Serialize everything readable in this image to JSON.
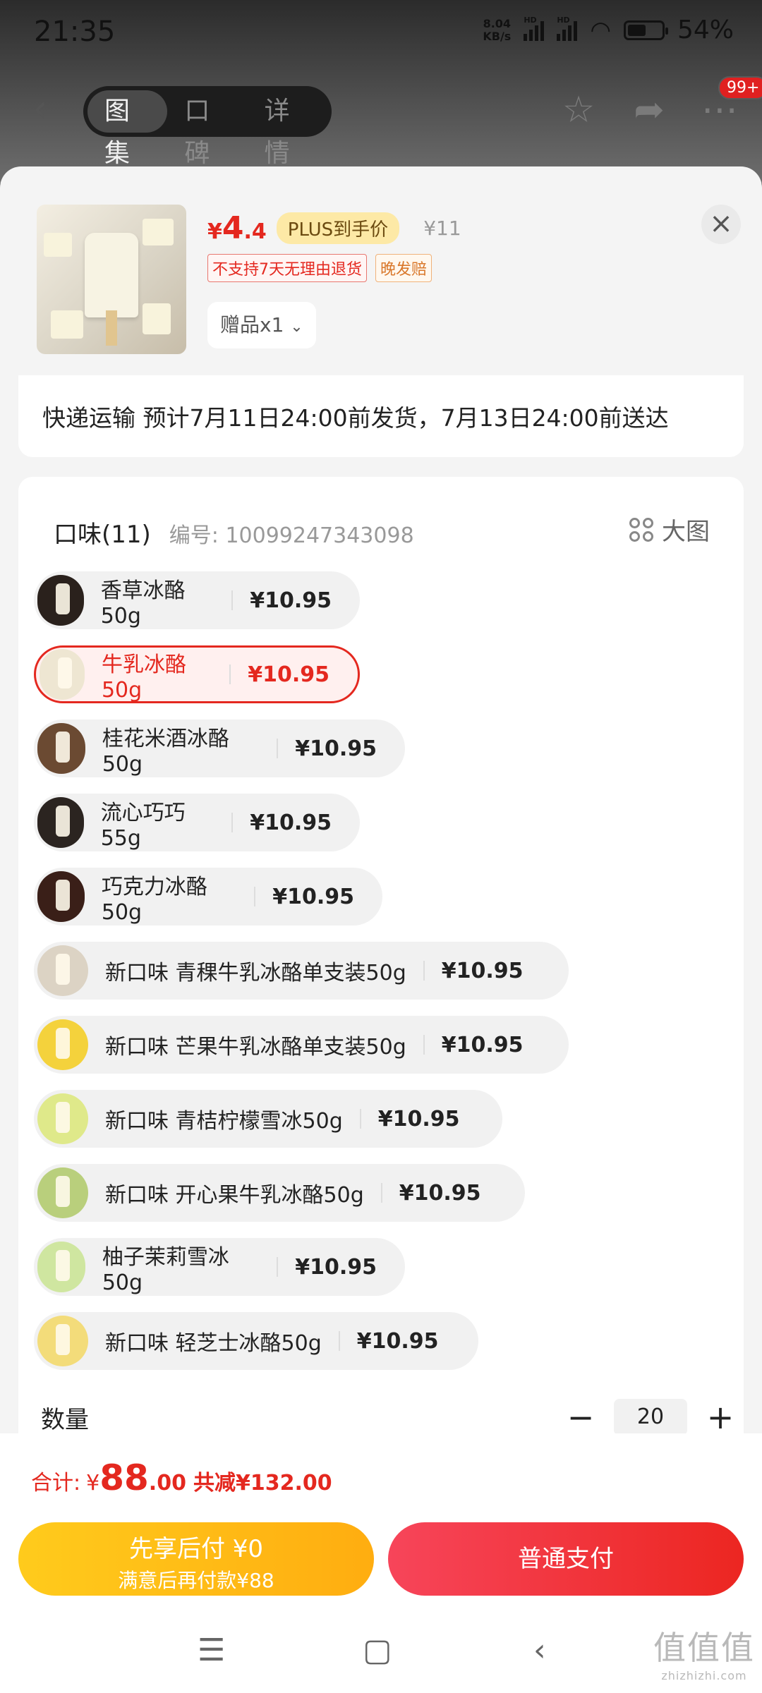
{
  "status": {
    "time": "21:35",
    "net_speed_top": "8.04",
    "net_speed_bottom": "KB/s",
    "hd": "HD",
    "battery": "54%",
    "battery_level": 0.54
  },
  "nav": {
    "tabs": [
      "图集",
      "口碑",
      "详情"
    ],
    "active_tab": 0,
    "badge": "99+"
  },
  "product": {
    "currency": "¥",
    "price_int": "4",
    "price_dec": ".4",
    "plus_label": "PLUS到手价",
    "original_price": "¥11",
    "tags": [
      "不支持7天无理由退货",
      "晚发赔"
    ],
    "gift": "赠品x1"
  },
  "shipping": "快递运输 预计7月11日24:00前发货，7月13日24:00前送达",
  "flavor": {
    "title": "口味(11)",
    "code": "编号: 10099247343098",
    "bigview": "大图",
    "options": [
      {
        "name": "香草冰酪50g",
        "price": "¥10.95",
        "color": "#2a211c"
      },
      {
        "name": "牛乳冰酪50g",
        "price": "¥10.95",
        "color": "#eee6d2",
        "selected": true
      },
      {
        "name": "桂花米酒冰酪50g",
        "price": "¥10.95",
        "color": "#6b4a32"
      },
      {
        "name": "流心巧巧55g",
        "price": "¥10.95",
        "color": "#2b2420"
      },
      {
        "name": "巧克力冰酪50g",
        "price": "¥10.95",
        "color": "#3a1f18"
      },
      {
        "name": "新口味 青稞牛乳冰酪单支装50g",
        "price": "¥10.95",
        "color": "#dcd3c4"
      },
      {
        "name": "新口味 芒果牛乳冰酪单支装50g",
        "price": "¥10.95",
        "color": "#f4d23c"
      },
      {
        "name": "新口味 青桔柠檬雪冰50g",
        "price": "¥10.95",
        "color": "#dfe98a"
      },
      {
        "name": "新口味 开心果牛乳冰酪50g",
        "price": "¥10.95",
        "color": "#b9cf7c"
      },
      {
        "name": "柚子茉莉雪冰50g",
        "price": "¥10.95",
        "color": "#cfe6a0"
      },
      {
        "name": "新口味 轻芝士冰酪50g",
        "price": "¥10.95",
        "color": "#f3dc7a"
      }
    ]
  },
  "quantity": {
    "label": "数量",
    "value": "20",
    "minus": "−",
    "plus": "+"
  },
  "footer": {
    "total_label": "合计:",
    "total_currency": "¥",
    "total_int": "88",
    "total_dec": ".00",
    "reduce": "共减¥132.00",
    "pay_later_l1": "先享后付 ¥0",
    "pay_later_l2": "满意后再付款¥88",
    "pay_normal": "普通支付"
  },
  "watermark": {
    "main": "值值值",
    "sub": "zhizhizhi.com"
  }
}
